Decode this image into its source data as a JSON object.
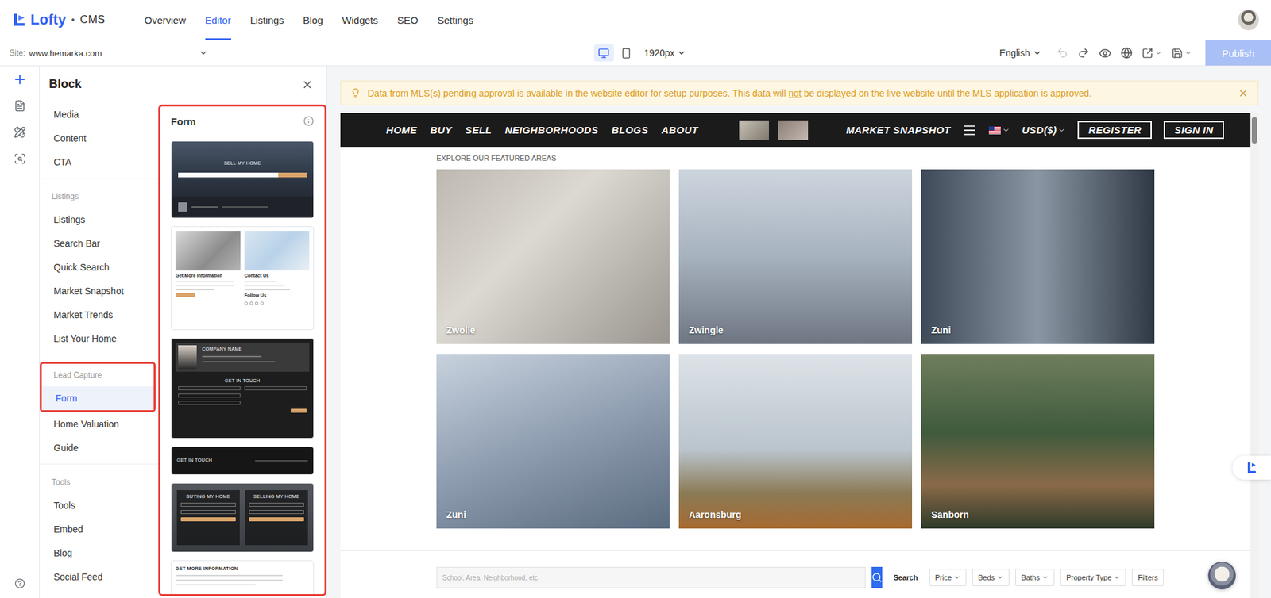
{
  "app": {
    "logo": "Lofty",
    "separator": "•",
    "product": "CMS"
  },
  "nav": [
    {
      "label": "Overview",
      "selected": false
    },
    {
      "label": "Editor",
      "selected": true
    },
    {
      "label": "Listings",
      "selected": false
    },
    {
      "label": "Blog",
      "selected": false
    },
    {
      "label": "Widgets",
      "selected": false
    },
    {
      "label": "SEO",
      "selected": false
    },
    {
      "label": "Settings",
      "selected": false
    }
  ],
  "toolbar": {
    "site_label": "Site:",
    "site": "www.hemarka.com",
    "devices": [
      {
        "kind": "desktop",
        "selected": true
      },
      {
        "kind": "mobile",
        "selected": false
      }
    ],
    "width": "1920px",
    "language": "English",
    "history": [
      {
        "kind": "undo",
        "disabled": true
      },
      {
        "kind": "redo",
        "disabled": false
      }
    ],
    "publish": {
      "label": "Publish",
      "disabled": true
    }
  },
  "rail": [
    {
      "kind": "add",
      "selected": true
    },
    {
      "kind": "pages",
      "selected": false
    },
    {
      "kind": "design",
      "selected": false
    },
    {
      "kind": "inspect",
      "selected": false
    }
  ],
  "block_panel": {
    "title": "Block",
    "groups": [
      {
        "highlighted": false,
        "items": [
          {
            "label": "Media",
            "selected": false
          },
          {
            "label": "Content",
            "selected": false
          },
          {
            "label": "CTA",
            "selected": false
          }
        ]
      },
      {
        "title": "Listings",
        "highlighted": false,
        "items": [
          {
            "label": "Listings",
            "selected": false
          },
          {
            "label": "Search Bar",
            "selected": false
          },
          {
            "label": "Quick Search",
            "selected": false
          },
          {
            "label": "Market Snapshot",
            "selected": false
          },
          {
            "label": "Market Trends",
            "selected": false
          },
          {
            "label": "List Your Home",
            "selected": false
          }
        ]
      },
      {
        "title": "Lead Capture",
        "highlighted": true,
        "items": [
          {
            "label": "Form",
            "selected": true
          },
          {
            "label": "Home Valuation",
            "selected": false
          },
          {
            "label": "Guide",
            "selected": false
          }
        ]
      },
      {
        "title": "Tools",
        "highlighted": false,
        "items": [
          {
            "label": "Tools",
            "selected": false
          },
          {
            "label": "Embed",
            "selected": false
          },
          {
            "label": "Blog",
            "selected": false
          },
          {
            "label": "Social Feed",
            "selected": false
          }
        ]
      }
    ],
    "gallery": {
      "title": "Form",
      "highlighted": true,
      "thumbnails": [
        {
          "kind": "hero",
          "title": "SELL MY HOME"
        },
        {
          "kind": "split",
          "title": "Get More Information",
          "contact": "Contact Us",
          "follow": "Follow Us"
        },
        {
          "kind": "agent",
          "company": "COMPANY NAME",
          "title": "GET IN TOUCH"
        },
        {
          "kind": "strip",
          "title": "GET IN TOUCH"
        },
        {
          "kind": "dual",
          "columns": [
            "BUYING MY HOME",
            "SELLING MY HOME"
          ]
        },
        {
          "kind": "plain",
          "title": "GET MORE INFORMATION"
        }
      ]
    }
  },
  "notice": {
    "before": "Data from MLS(s) pending approval is available in the website editor for setup purposes. This data will ",
    "emphasis": "not",
    "after": " be displayed on the live website until the MLS application is approved."
  },
  "site_preview": {
    "nav": [
      "HOME",
      "BUY",
      "SELL",
      "NEIGHBORHOODS",
      "BLOGS",
      "ABOUT"
    ],
    "market": "MARKET SNAPSHOT",
    "currency": "USD($)",
    "register": "REGISTER",
    "sign_in": "SIGN IN",
    "section_label": "EXPLORE OUR FEATURED AREAS",
    "areas": [
      "Zwolle",
      "Zwingle",
      "Zuni",
      "Zuni",
      "Aaronsburg",
      "Sanborn"
    ],
    "search": {
      "placeholder": "School, Area, Neighborhood, etc",
      "button": "Search",
      "filters": [
        {
          "label": "Price",
          "dropdown": true
        },
        {
          "label": "Beds",
          "dropdown": true
        },
        {
          "label": "Baths",
          "dropdown": true
        },
        {
          "label": "Property Type",
          "dropdown": true
        },
        {
          "label": "Filters",
          "dropdown": false
        }
      ]
    }
  }
}
